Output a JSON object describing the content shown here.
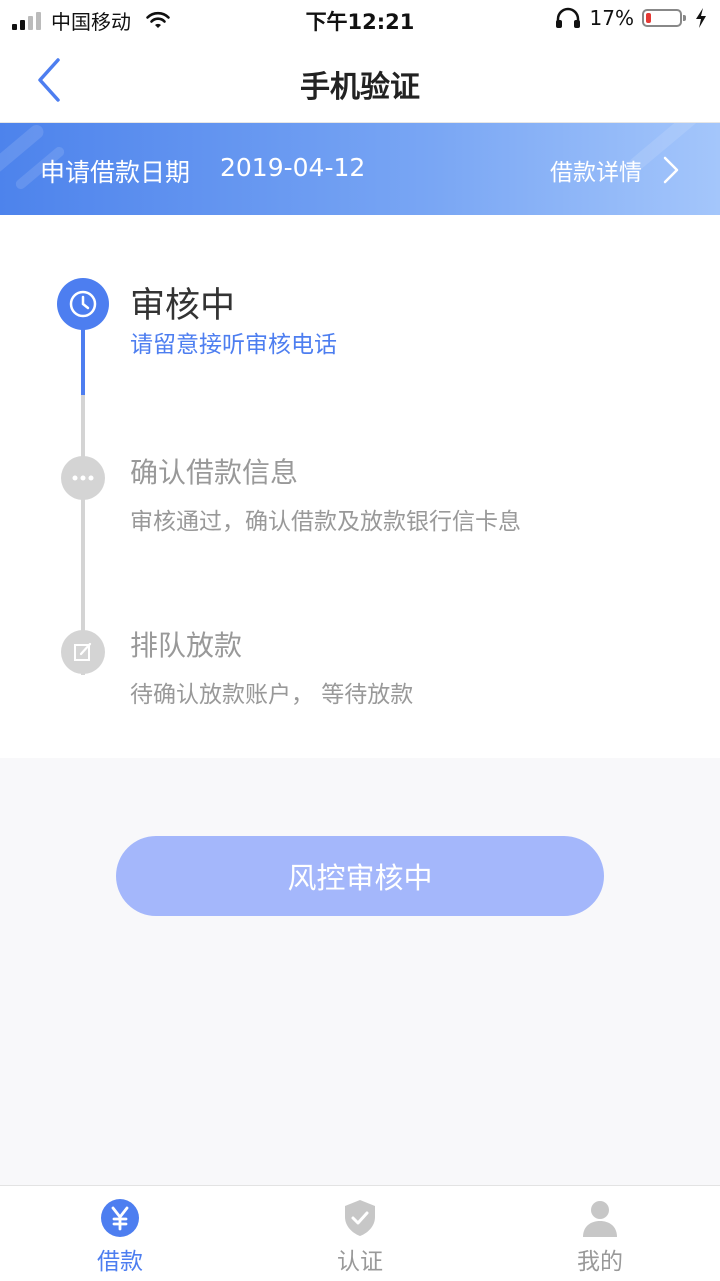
{
  "status_bar": {
    "carrier": "中国移动",
    "time": "下午12:21",
    "battery_percent": "17%",
    "battery_level": 0.17
  },
  "nav": {
    "title": "手机验证",
    "back_icon": "chevron-left-icon"
  },
  "banner": {
    "label": "申请借款日期",
    "date": "2019-04-12",
    "detail_link": "借款详情",
    "detail_icon": "chevron-right-icon"
  },
  "timeline": {
    "steps": [
      {
        "title": "审核中",
        "desc": "请留意接听审核电话",
        "icon": "clock-icon",
        "active": true
      },
      {
        "title": "确认借款信息",
        "desc": "审核通过，确认借款及放款银行信卡息",
        "icon": "more-dots-icon",
        "active": false
      },
      {
        "title": "排队放款",
        "desc": "待确认放款账户， 等待放款",
        "icon": "edit-icon",
        "active": false
      }
    ]
  },
  "action": {
    "button_label": "风控审核中"
  },
  "tabs": [
    {
      "label": "借款",
      "icon": "yen-icon",
      "active": true
    },
    {
      "label": "认证",
      "icon": "shield-check-icon",
      "active": false
    },
    {
      "label": "我的",
      "icon": "user-icon",
      "active": false
    }
  ],
  "colors": {
    "accent": "#4d7ef0",
    "inactive": "#c7c7c7",
    "button": "#a4b7fb",
    "banner_start": "#4d83ec",
    "banner_end": "#a4c6fb"
  }
}
